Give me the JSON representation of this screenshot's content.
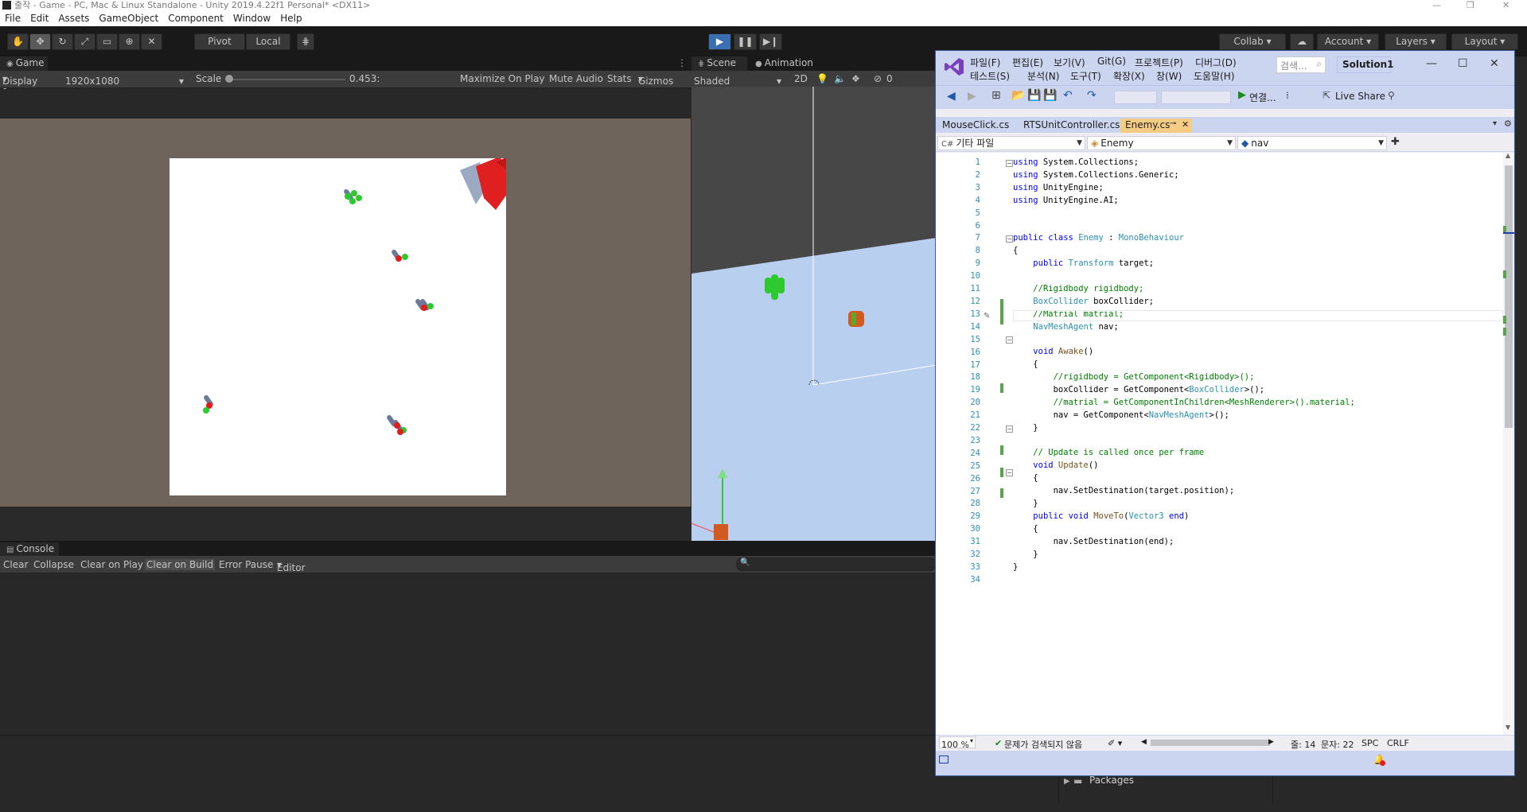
{
  "unity": {
    "title": "출작 - Game - PC, Mac & Linux Standalone - Unity 2019.4.22f1 Personal* <DX11>",
    "menu": [
      "File",
      "Edit",
      "Assets",
      "GameObject",
      "Component",
      "Window",
      "Help"
    ],
    "toolbar": {
      "pivot": "Pivot",
      "local": "Local",
      "collab": "Collab",
      "account": "Account",
      "layers": "Layers",
      "layout": "Layout"
    },
    "game": {
      "tab": "Game",
      "display": "Display 1",
      "resolution": "1920x1080",
      "scale_label": "Scale",
      "scale_value": "0.453:",
      "maximize": "Maximize On Play",
      "mute": "Mute Audio",
      "stats": "Stats",
      "gizmos": "Gizmos"
    },
    "scene": {
      "tab_scene": "Scene",
      "tab_animation": "Animation",
      "shading": "Shaded",
      "mode_2d": "2D",
      "hidden_count": "0"
    },
    "console": {
      "tab": "Console",
      "buttons": [
        "Clear",
        "Collapse",
        "Clear on Play",
        "Clear on Build",
        "Error Pause",
        "Editor"
      ]
    },
    "project": {
      "packages": "Packages"
    }
  },
  "vs": {
    "menu_row1": [
      "파일(F)",
      "편집(E)",
      "보기(V)",
      "Git(G)",
      "프로젝트(P)",
      "디버그(D)"
    ],
    "menu_row2": [
      "테스트(S)",
      "분석(N)",
      "도구(T)",
      "확장(X)",
      "창(W)",
      "도움말(H)"
    ],
    "search_placeholder": "검색...",
    "solution": "Solution1",
    "toolbar": {
      "connect": "연결...",
      "live_share": "Live Share"
    },
    "tabs": [
      "MouseClick.cs",
      "RTSUnitController.cs",
      "Enemy.cs"
    ],
    "nav": {
      "project": "기타 파일",
      "class": "Enemy",
      "member": "nav"
    },
    "code": [
      {
        "n": "1",
        "text": "using System.Collections;"
      },
      {
        "n": "2",
        "text": "using System.Collections.Generic;"
      },
      {
        "n": "3",
        "text": "using UnityEngine;"
      },
      {
        "n": "4",
        "text": "using UnityEngine.AI;"
      },
      {
        "n": "5",
        "text": ""
      },
      {
        "n": "6",
        "text": ""
      },
      {
        "n": "7",
        "text": "public class Enemy : MonoBehaviour"
      },
      {
        "n": "8",
        "text": "{"
      },
      {
        "n": "9",
        "text": "    public Transform target;"
      },
      {
        "n": "10",
        "text": ""
      },
      {
        "n": "11",
        "text": "    //Rigidbody rigidbody;"
      },
      {
        "n": "12",
        "text": "    BoxCollider boxCollider;"
      },
      {
        "n": "13",
        "text": "    //Matrial matrial;"
      },
      {
        "n": "14",
        "text": "    NavMeshAgent nav;"
      },
      {
        "n": "15",
        "text": ""
      },
      {
        "n": "16",
        "text": "    void Awake()"
      },
      {
        "n": "17",
        "text": "    {"
      },
      {
        "n": "18",
        "text": "        //rigidbody = GetComponent<Rigidbody>();"
      },
      {
        "n": "19",
        "text": "        boxCollider = GetComponent<BoxCollider>();"
      },
      {
        "n": "20",
        "text": "        //matrial = GetComponentInChildren<MeshRenderer>().material;"
      },
      {
        "n": "21",
        "text": "        nav = GetComponent<NavMeshAgent>();"
      },
      {
        "n": "22",
        "text": "    }"
      },
      {
        "n": "23",
        "text": ""
      },
      {
        "n": "24",
        "text": "    // Update is called once per frame"
      },
      {
        "n": "25",
        "text": "    void Update()"
      },
      {
        "n": "26",
        "text": "    {"
      },
      {
        "n": "27",
        "text": "        nav.SetDestination(target.position);"
      },
      {
        "n": "28",
        "text": "    }"
      },
      {
        "n": "29",
        "text": "    public void MoveTo(Vector3 end)"
      },
      {
        "n": "30",
        "text": "    {"
      },
      {
        "n": "31",
        "text": "        nav.SetDestination(end);"
      },
      {
        "n": "32",
        "text": "    }"
      },
      {
        "n": "33",
        "text": "}"
      },
      {
        "n": "34",
        "text": ""
      }
    ],
    "status": {
      "zoom": "100 %",
      "issues": "문제가 검색되지 않음",
      "line": "줄: 14",
      "col": "문자: 22",
      "spc": "SPC",
      "crlf": "CRLF"
    },
    "colors": {
      "header": "#ccd5f0",
      "active_tab": "#f5cc84",
      "keyword": "#0000ff",
      "type": "#2b91af",
      "comment": "#008000"
    }
  }
}
